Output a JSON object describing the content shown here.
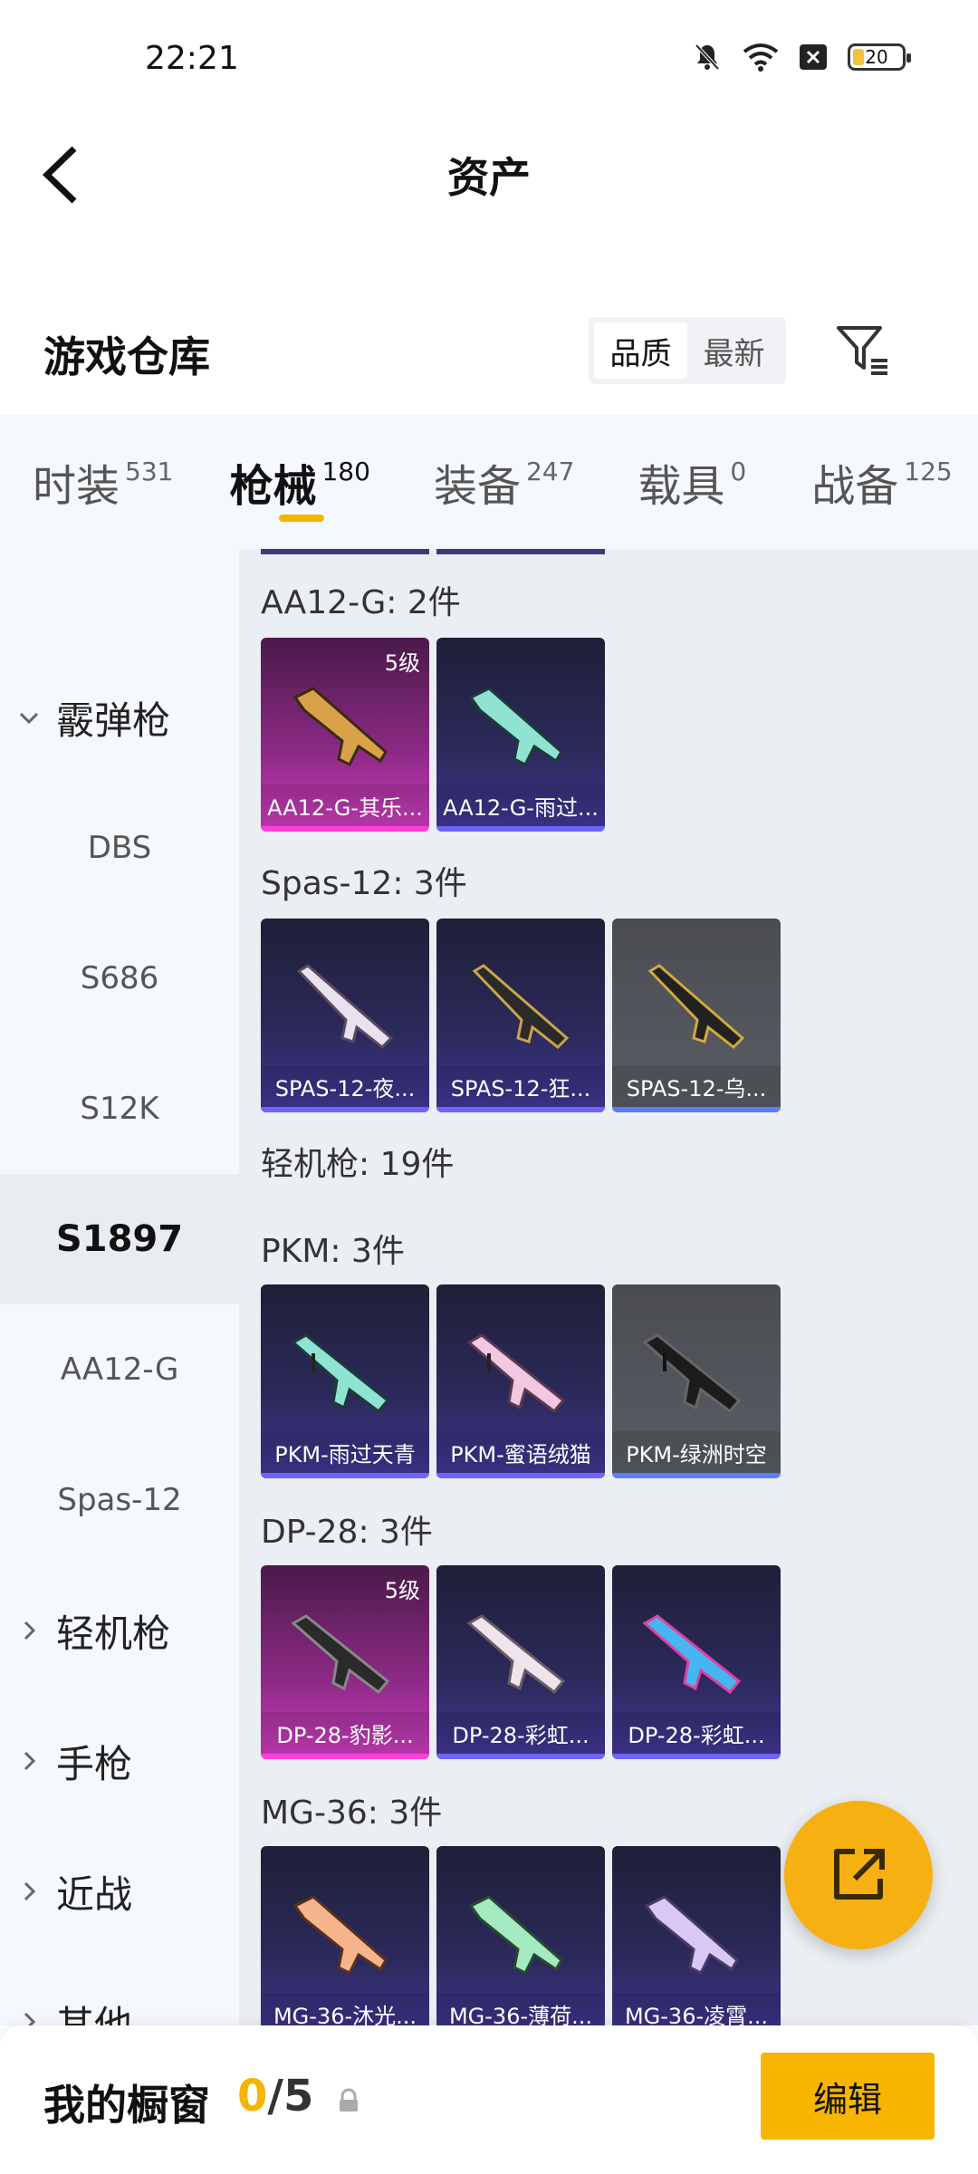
{
  "status": {
    "time": "22:21",
    "battery": "20"
  },
  "header": {
    "title": "资产"
  },
  "section": {
    "title": "游戏仓库",
    "sort_options": [
      "品质",
      "最新"
    ]
  },
  "tabs": [
    {
      "label": "时装",
      "count": "531"
    },
    {
      "label": "枪械",
      "count": "180"
    },
    {
      "label": "装备",
      "count": "247"
    },
    {
      "label": "载具",
      "count": "0"
    },
    {
      "label": "战备",
      "count": "125"
    }
  ],
  "sidebar": {
    "group_shotgun": "霰弹枪",
    "items": [
      "DBS",
      "S686",
      "S12K",
      "S1897",
      "AA12-G",
      "Spas-12"
    ],
    "groups": [
      "轻机枪",
      "手枪",
      "近战",
      "其他"
    ]
  },
  "content": {
    "aa12": {
      "label": "AA12-G: 2件",
      "cards": [
        {
          "name": "AA12-G-其乐...",
          "level": "5级"
        },
        {
          "name": "AA12-G-雨过..."
        }
      ]
    },
    "spas": {
      "label": "Spas-12: 3件",
      "cards": [
        {
          "name": "SPAS-12-夜..."
        },
        {
          "name": "SPAS-12-狂..."
        },
        {
          "name": "SPAS-12-乌..."
        }
      ]
    },
    "lmg_total": "轻机枪: 19件",
    "pkm": {
      "label": "PKM: 3件",
      "cards": [
        {
          "name": "PKM-雨过天青"
        },
        {
          "name": "PKM-蜜语绒猫"
        },
        {
          "name": "PKM-绿洲时空"
        }
      ]
    },
    "dp28": {
      "label": "DP-28: 3件",
      "cards": [
        {
          "name": "DP-28-豹影...",
          "level": "5级"
        },
        {
          "name": "DP-28-彩虹..."
        },
        {
          "name": "DP-28-彩虹..."
        }
      ]
    },
    "mg36": {
      "label": "MG-36: 3件",
      "cards": [
        {
          "name": "MG-36-沐光..."
        },
        {
          "name": "MG-36-薄荷..."
        },
        {
          "name": "MG-36-凌霄..."
        }
      ]
    }
  },
  "bottom": {
    "title": "我的橱窗",
    "current": "0",
    "total": "/5",
    "edit_label": "编辑"
  },
  "colors": {
    "accent": "#f5b400",
    "card_purple": "#2c2a5c",
    "card_pink": "#d23fc4",
    "card_gray": "#5a5d64"
  }
}
